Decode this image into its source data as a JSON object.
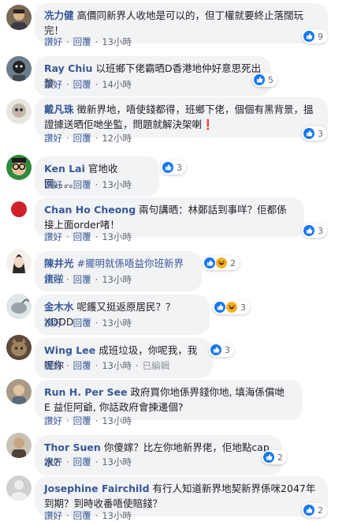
{
  "labels": {
    "like": "讚好",
    "reply": "回覆",
    "edited": "已編輯",
    "sep": "·"
  },
  "comments": [
    {
      "name": "冼力健",
      "text": "高價同新界人收地是可以的，但丁權就要終止落闊玩完！",
      "time": "13小時",
      "reaction": {
        "icons": [
          "like-icon"
        ],
        "count": "9"
      }
    },
    {
      "name": "Ray Chiu",
      "text": "以班鄉下佬霸晒D香港地仲好意思死出黎",
      "time": "14小時",
      "reaction": {
        "icons": [
          "like-icon"
        ],
        "count": "5"
      }
    },
    {
      "name": "戴凡珠",
      "text": "徵新界地，唔使錢都得，班鄉下佬，個個有黑背景，搵證據送晒佢哋坐監，問題就解決架喇❗",
      "time": "12小時",
      "reaction": {
        "icons": [
          "like-icon"
        ],
        "count": "3"
      }
    },
    {
      "name": "Ken Lai",
      "text": "官地收回。。。。",
      "time": "13小時",
      "reaction": {
        "icons": [
          "like-icon"
        ],
        "count": "3"
      }
    },
    {
      "name": "Chan Ho Cheong",
      "text": "兩句講晒：林鄭話到事咩？佢都係接上面order啫！",
      "time": "13小時",
      "reaction": {
        "icons": [
          "like-icon"
        ],
        "count": "3"
      }
    },
    {
      "name": "陳井光",
      "text": "#擺明就係唔益你班新界佬啦",
      "time": "13小時",
      "reaction": {
        "icons": [
          "like-icon",
          "haha-icon"
        ],
        "count": "2"
      }
    },
    {
      "name": "金木水",
      "text": "呢鑊又挺返原居民？？ XDDD",
      "time": "13小時",
      "reaction": {
        "icons": [
          "like-icon",
          "haha-icon"
        ],
        "count": "3"
      }
    },
    {
      "name": "Wing Lee",
      "text": "成班垃圾，你呢我，我呢你",
      "time": "13小時",
      "edited": true,
      "reaction": {
        "icons": [
          "like-icon"
        ],
        "count": "3"
      }
    },
    {
      "name": "Run H. Per See",
      "text": "政府買你地係畀錢你地, 填海係償哋 E 益佢阿爺, 你話政府會揀邊個?",
      "time": "13小時",
      "reaction": null
    },
    {
      "name": "Thor Suen",
      "text": "你傻嫁？比左你地新界佬，佢地點cap水？",
      "time": "13小時",
      "reaction": {
        "icons": [
          "like-icon"
        ],
        "count": "2"
      }
    },
    {
      "name": "Josephine Fairchild",
      "text": "有行人知道新界地契新界係咪2047年到期？到時收番唔使賠錢？",
      "time": "13小時",
      "reaction": {
        "icons": [
          "like-icon"
        ],
        "count": "2"
      }
    }
  ],
  "colors": {
    "name": "#385898",
    "bubble": "#f2f3f5",
    "like": "#1877f2",
    "haha": "#f7b125",
    "meta": "#606770"
  }
}
